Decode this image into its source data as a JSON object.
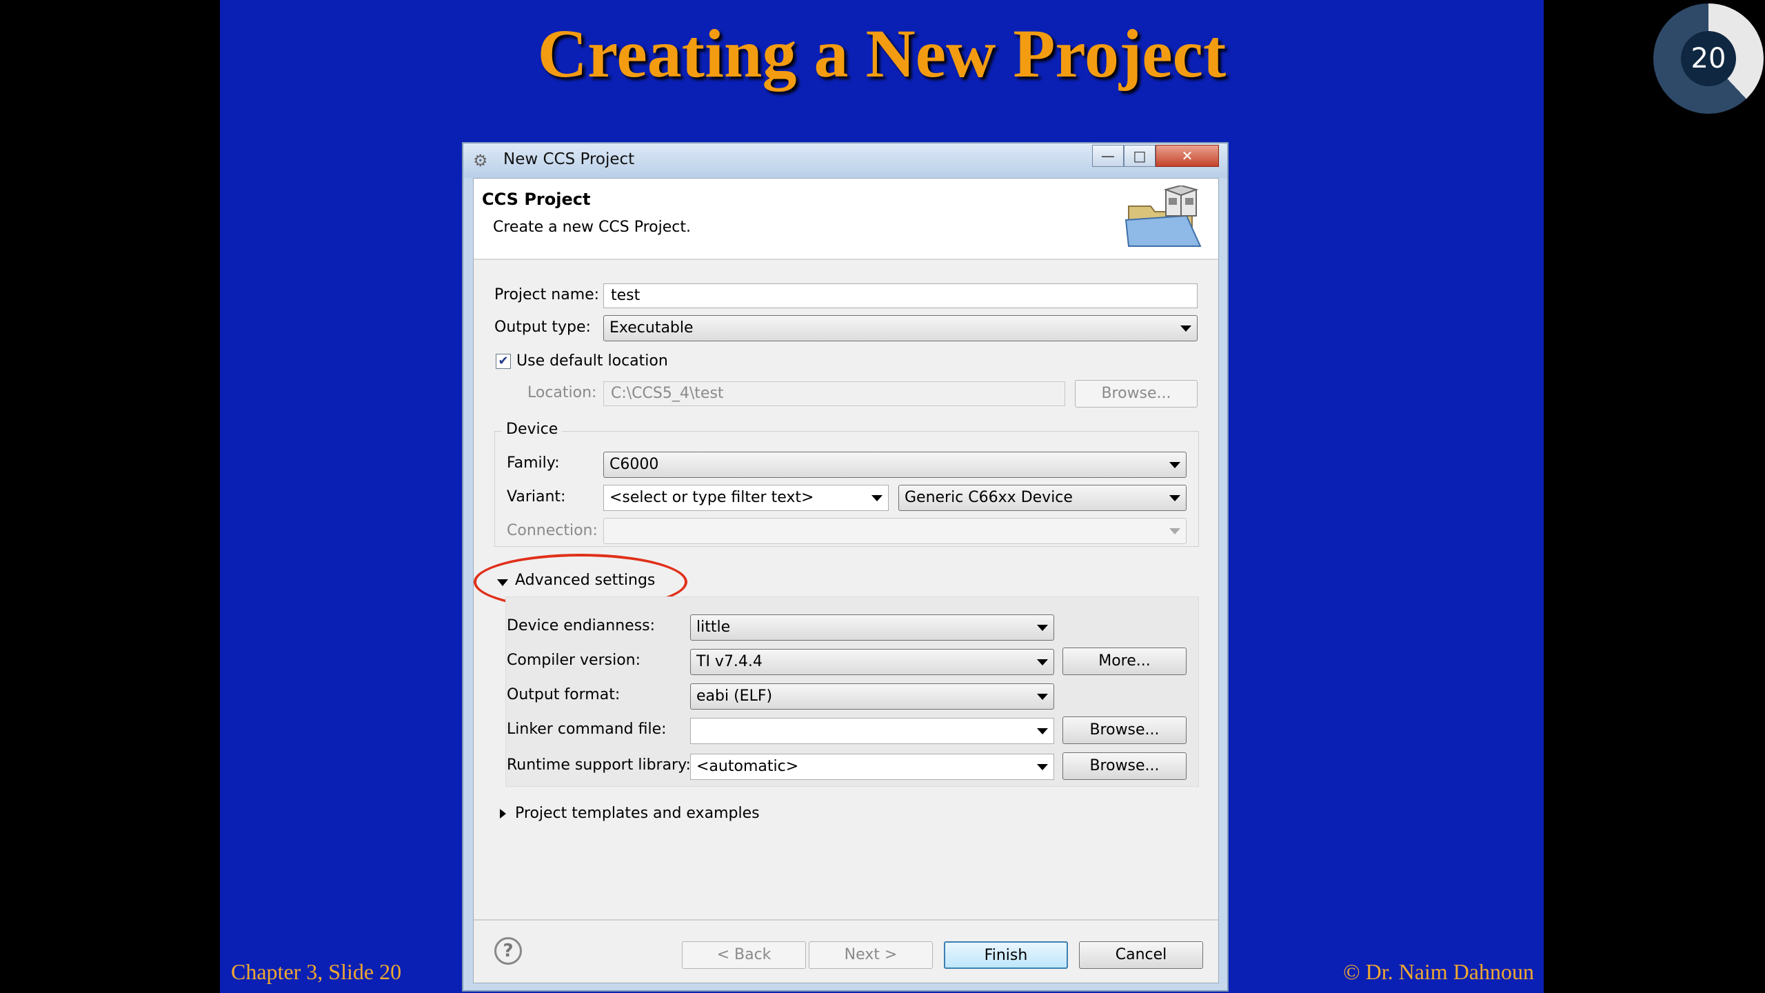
{
  "slide": {
    "title": "Creating a New Project",
    "footer_left": "Chapter 3, Slide 20",
    "footer_right": "© Dr. Naim Dahnoun",
    "badge_number": "20",
    "badge_progress": 0.38
  },
  "dialog": {
    "window_title": "New CCS Project",
    "window_icon": "ccs-gear-icon",
    "header_title": "CCS Project",
    "header_subtitle": "Create a new CCS Project.",
    "project_name_label": "Project name:",
    "project_name_value": "test",
    "output_type_label": "Output type:",
    "output_type_value": "Executable",
    "use_default_location_label": "Use default location",
    "use_default_location_checked": true,
    "location_label": "Location:",
    "location_value": "C:\\CCS5_4\\test",
    "browse_label": "Browse...",
    "device": {
      "group_label": "Device",
      "family_label": "Family:",
      "family_value": "C6000",
      "variant_label": "Variant:",
      "variant_filter_placeholder": "<select or type filter text>",
      "variant_value": "Generic C66xx Device",
      "connection_label": "Connection:",
      "connection_value": ""
    },
    "advanced": {
      "toggle_label": "Advanced settings",
      "endianness_label": "Device endianness:",
      "endianness_value": "little",
      "compiler_label": "Compiler version:",
      "compiler_value": "TI v7.4.4",
      "more_label": "More...",
      "output_format_label": "Output format:",
      "output_format_value": "eabi (ELF)",
      "linker_label": "Linker command file:",
      "linker_value": "",
      "linker_browse_label": "Browse...",
      "runtime_label": "Runtime support library:",
      "runtime_value": "<automatic>",
      "runtime_browse_label": "Browse..."
    },
    "templates_label": "Project templates and examples",
    "buttons": {
      "help_label": "?",
      "back": "< Back",
      "next": "Next >",
      "finish": "Finish",
      "cancel": "Cancel"
    },
    "highlight_color": "#e0301a"
  }
}
